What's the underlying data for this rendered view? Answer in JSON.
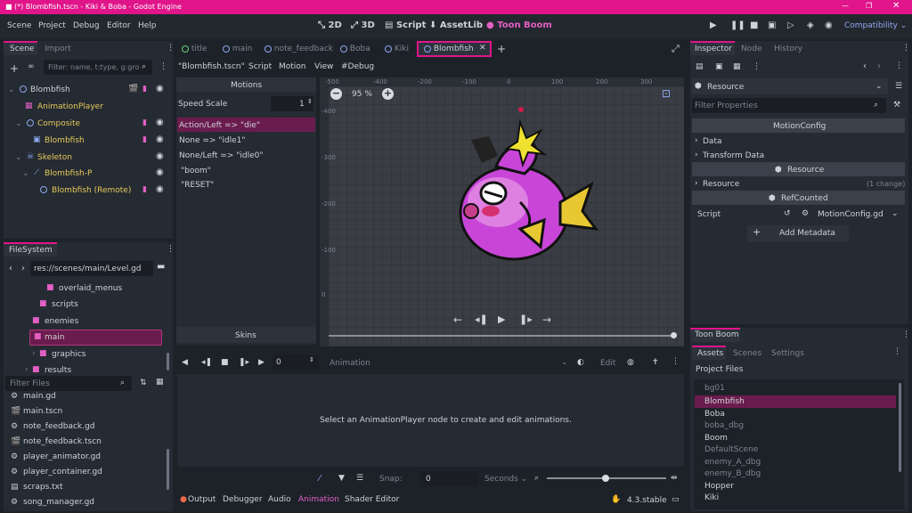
{
  "window": {
    "title": "(*) Blombfish.tscn - Kiki & Boba - Godot Engine"
  },
  "menu": {
    "items": [
      "Scene",
      "Project",
      "Debug",
      "Editor",
      "Help"
    ],
    "workspaces": [
      "2D",
      "3D",
      "Script",
      "AssetLib",
      "Toon Boom"
    ],
    "renderer": "Compatibility"
  },
  "scene_dock": {
    "tabs": [
      "Scene",
      "Import"
    ],
    "filter_placeholder": "Filter: name, t:type, g:gro",
    "tree": [
      {
        "label": "Blombfish",
        "type": "root"
      },
      {
        "label": "AnimationPlayer",
        "type": "anim"
      },
      {
        "label": "Composite",
        "type": "node"
      },
      {
        "label": "Blombfish",
        "type": "sprite"
      },
      {
        "label": "Skeleton",
        "type": "skeleton"
      },
      {
        "label": "Blombfish-P",
        "type": "bone"
      },
      {
        "label": "Blombfish (Remote)",
        "type": "remote"
      }
    ]
  },
  "filesystem": {
    "tab": "FileSystem",
    "path": "res://scenes/main/Level.gd",
    "folders": [
      {
        "label": "overlaid_menus"
      },
      {
        "label": "scripts"
      },
      {
        "label": "enemies"
      },
      {
        "label": "main"
      },
      {
        "label": "graphics"
      },
      {
        "label": "results"
      }
    ],
    "filter_placeholder": "Filter Files",
    "files": [
      "main.gd",
      "main.tscn",
      "note_feedback.gd",
      "note_feedback.tscn",
      "player_animator.gd",
      "player_container.gd",
      "scraps.txt",
      "song_manager.gd"
    ]
  },
  "editor_tabs": [
    "title",
    "main",
    "note_feedback",
    "Boba",
    "Kiki",
    "Blombfish"
  ],
  "toolbar": {
    "file": "\"Blombfish.tscn\"",
    "items": [
      "Script",
      "Motion",
      "View",
      "#Debug"
    ]
  },
  "motions": {
    "header": "Motions",
    "speed_label": "Speed Scale",
    "speed_value": "1",
    "list": [
      "Action/Left => \"die\"",
      "None => \"idle1\"",
      "None/Left => \"idle0\"",
      "\"boom\"",
      "\"RESET\""
    ],
    "skins_label": "Skins"
  },
  "viewport": {
    "zoom": "95 %",
    "ruler_top": [
      "-500",
      "-400",
      "-300",
      "-200",
      "-100",
      "0",
      "100",
      "200",
      "300"
    ],
    "ruler_left": [
      "-400",
      "-300",
      "-200",
      "-100",
      "0"
    ]
  },
  "animation": {
    "frame_value": "0",
    "label": "Animation",
    "edit": "Edit",
    "message": "Select an AnimationPlayer node to create and edit animations.",
    "snap_label": "Snap:",
    "snap_value": "0",
    "unit": "Seconds"
  },
  "bottom_tabs": [
    "Output",
    "Debugger",
    "Audio",
    "Animation",
    "Shader Editor"
  ],
  "version": "4.3.stable",
  "inspector": {
    "tabs": [
      "Inspector",
      "Node",
      "History"
    ],
    "resource": "Resource",
    "filter_placeholder": "Filter Properties",
    "class": "MotionConfig",
    "sections": [
      "Data",
      "Transform Data"
    ],
    "resource_header": "Resource",
    "resource_row": "Resource",
    "resource_change": "(1 change)",
    "refcounted": "RefCounted",
    "script_label": "Script",
    "script_value": "MotionConfig.gd",
    "add_metadata": "Add Metadata"
  },
  "toonboom": {
    "title": "Toon Boom",
    "tabs": [
      "Assets",
      "Scenes",
      "Settings"
    ],
    "section": "Project Files",
    "files": [
      {
        "name": "bg01",
        "dim": true
      },
      {
        "name": "Blombfish",
        "dim": false
      },
      {
        "name": "Boba",
        "dim": false
      },
      {
        "name": "boba_dbg",
        "dim": true
      },
      {
        "name": "Boom",
        "dim": false
      },
      {
        "name": "DefaultScene",
        "dim": true
      },
      {
        "name": "enemy_A_dbg",
        "dim": true
      },
      {
        "name": "enemy_B_dbg",
        "dim": true
      },
      {
        "name": "Hopper",
        "dim": false
      },
      {
        "name": "Kiki",
        "dim": false
      }
    ]
  },
  "colors": {
    "accent": "#e0158a",
    "selection": "#6b1c4e"
  }
}
